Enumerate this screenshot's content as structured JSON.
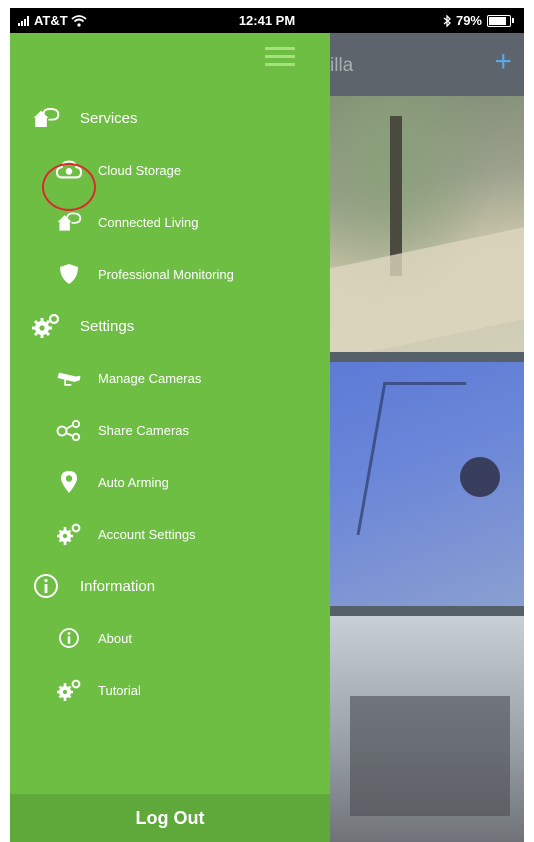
{
  "status_bar": {
    "carrier": "AT&T",
    "time": "12:41 PM",
    "battery": "79%"
  },
  "app": {
    "brand_fragment": "illa",
    "add_symbol": "+"
  },
  "menu": {
    "services": {
      "label": "Services",
      "items": [
        {
          "label": "Cloud Storage",
          "icon": "cloud-icon"
        },
        {
          "label": "Connected Living",
          "icon": "house-icon"
        },
        {
          "label": "Professional Monitoring",
          "icon": "shield-icon"
        }
      ]
    },
    "settings": {
      "label": "Settings",
      "items": [
        {
          "label": "Manage Cameras",
          "icon": "camera-icon"
        },
        {
          "label": "Share Cameras",
          "icon": "share-icon"
        },
        {
          "label": "Auto Arming",
          "icon": "location-pin-icon"
        },
        {
          "label": "Account Settings",
          "icon": "gear-icon"
        }
      ]
    },
    "information": {
      "label": "Information",
      "items": [
        {
          "label": "About",
          "icon": "info-icon"
        },
        {
          "label": "Tutorial",
          "icon": "gear-icon"
        }
      ]
    },
    "logout_label": "Log Out"
  },
  "colors": {
    "drawer": "#6fbe44",
    "logout": "#5fa83a",
    "highlight": "#d92b2b",
    "plus": "#5aa8e6"
  }
}
